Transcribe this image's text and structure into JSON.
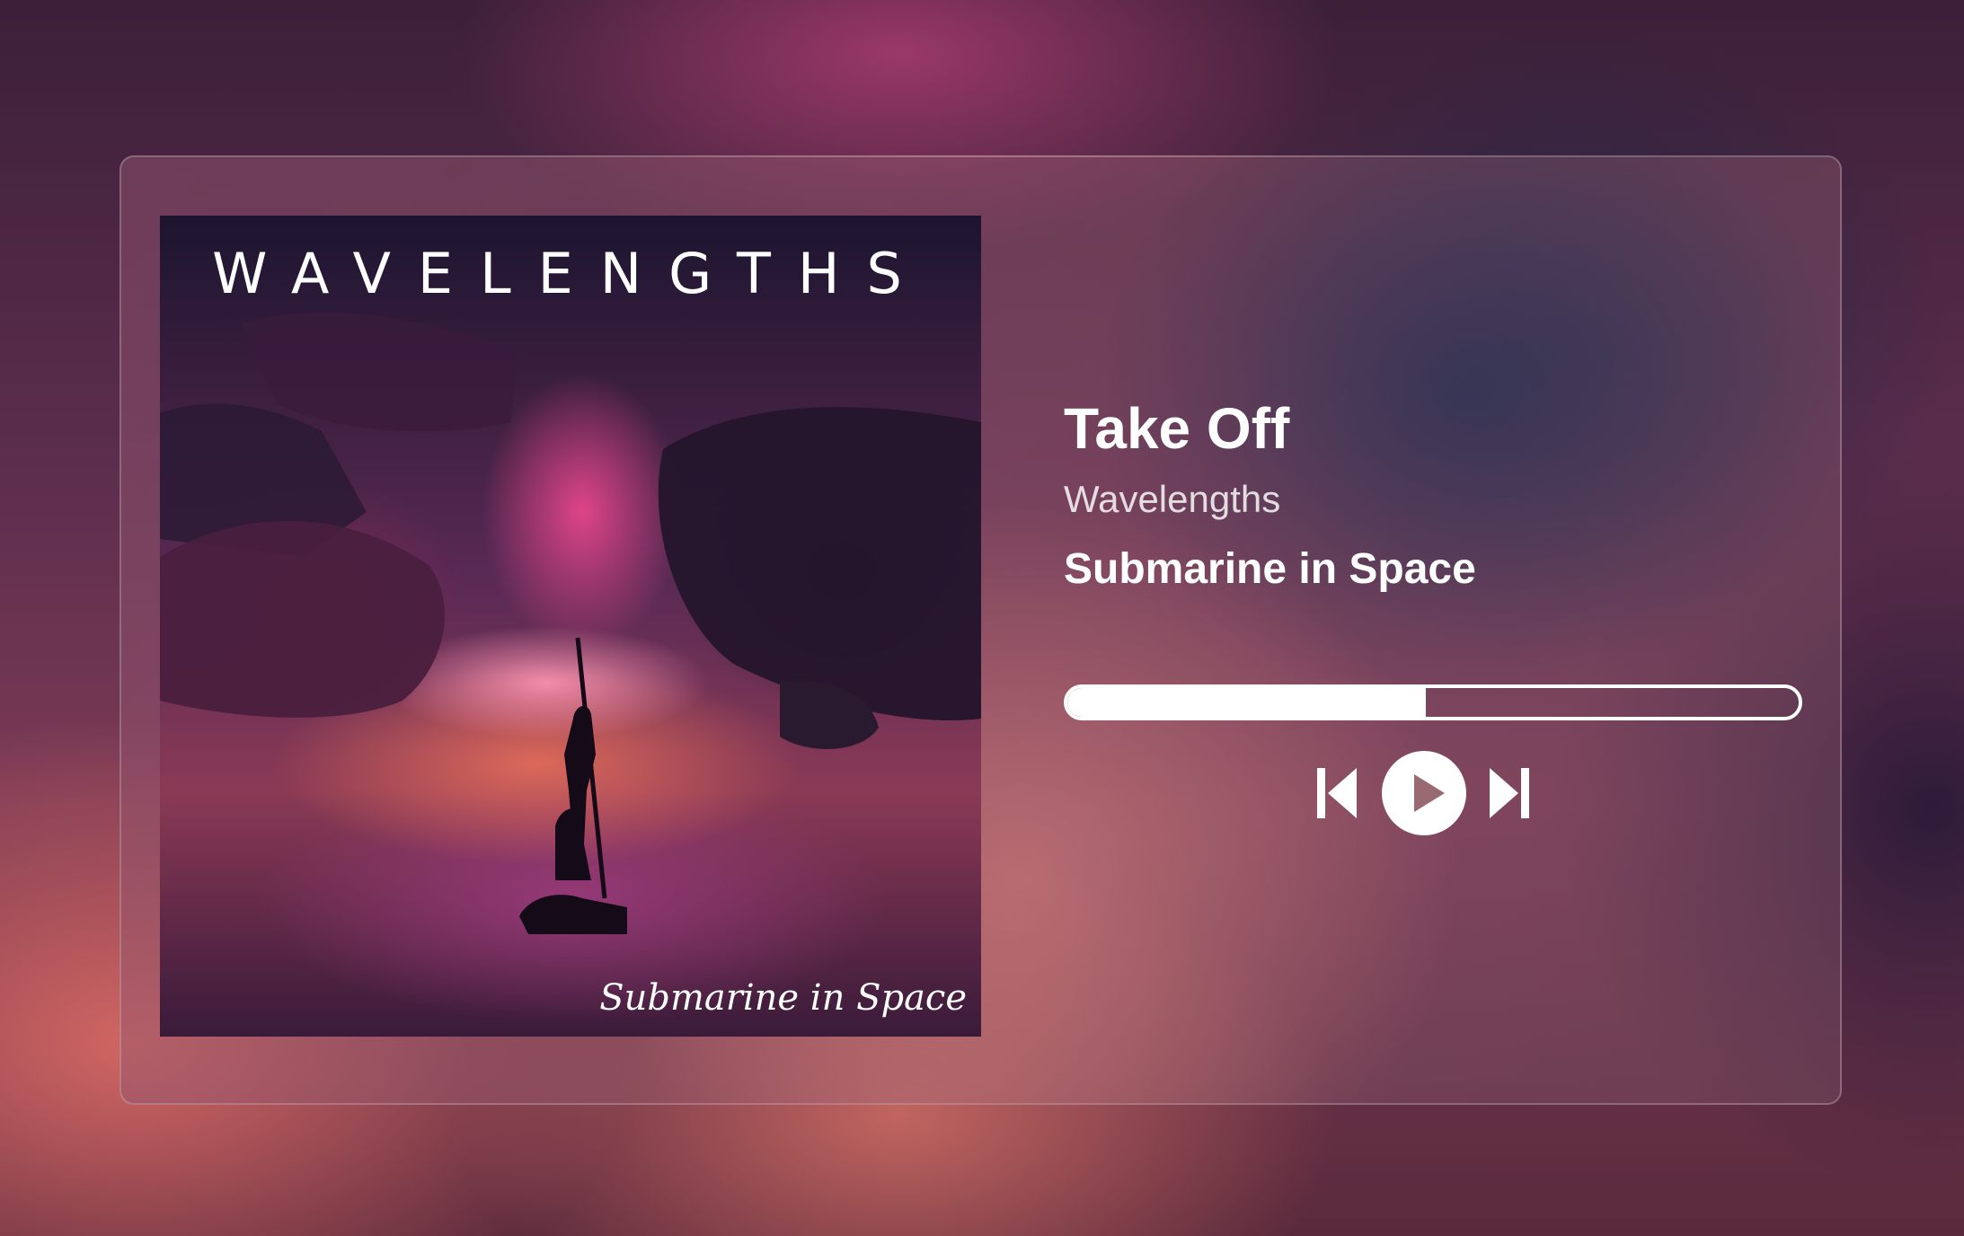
{
  "track": {
    "title": "Take Off",
    "artist": "Wavelengths",
    "album": "Submarine in Space"
  },
  "cover": {
    "brand_text": "WAVELENGTHS",
    "album_text": "Submarine in Space"
  },
  "player": {
    "progress": 0.49,
    "controls": [
      "previous-icon",
      "play-icon",
      "next-icon"
    ]
  },
  "colors": {
    "text": "#ffffff",
    "progress": "#ffffff"
  }
}
